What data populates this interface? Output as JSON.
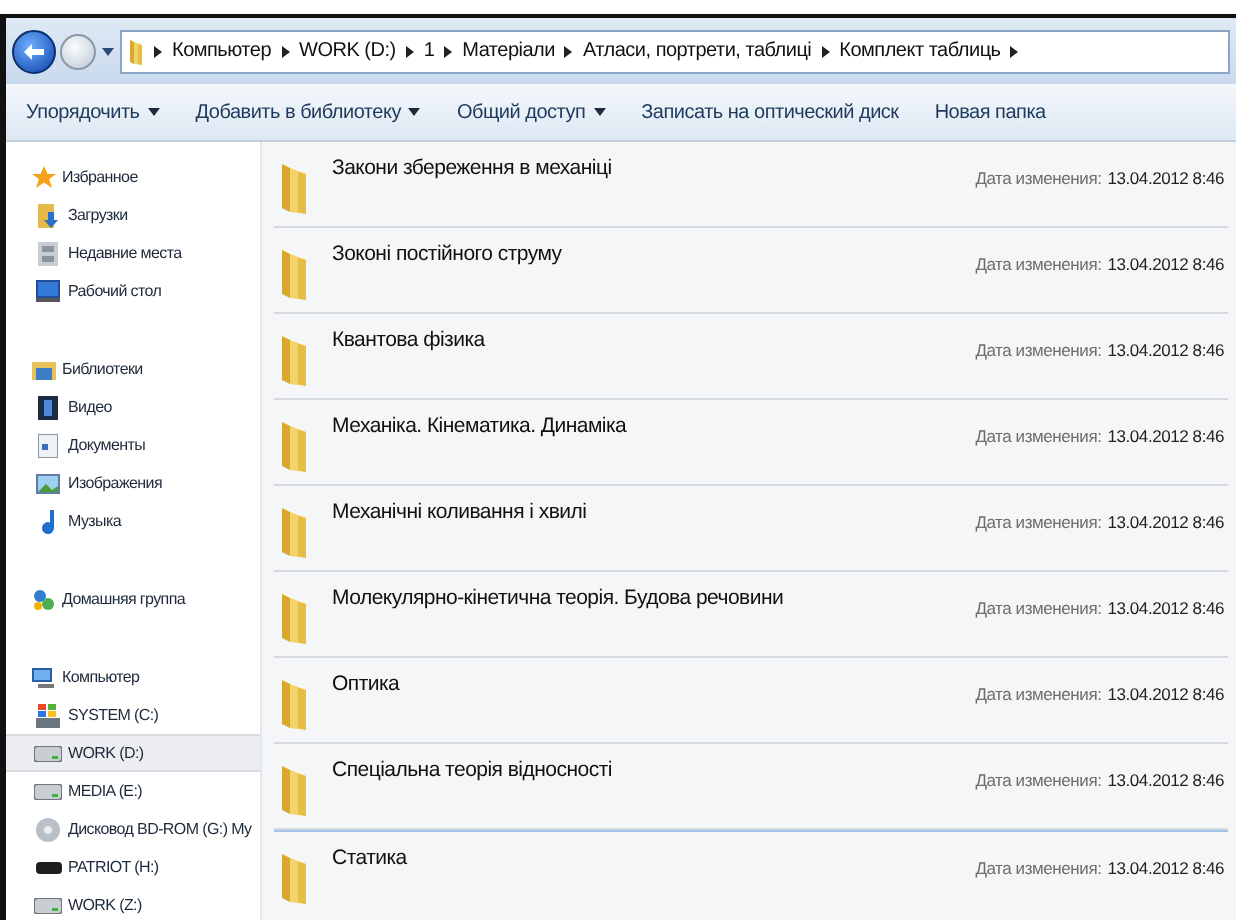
{
  "address_bar": {
    "crumbs": [
      "Компьютер",
      "WORK (D:)",
      "1",
      "Матеріали",
      "Атласи, портрети, таблиці",
      "Комплект таблиць"
    ]
  },
  "toolbar": [
    {
      "label": "Упорядочить",
      "dropdown": true
    },
    {
      "label": "Добавить в библиотеку",
      "dropdown": true
    },
    {
      "label": "Общий доступ",
      "dropdown": true
    },
    {
      "label": "Записать на оптический диск",
      "dropdown": false
    },
    {
      "label": "Новая папка",
      "dropdown": false
    }
  ],
  "sidebar": [
    {
      "title": "Избранное",
      "items": [
        {
          "label": "Загрузки",
          "selected": false
        },
        {
          "label": "Недавние места",
          "selected": false
        },
        {
          "label": "Рабочий стол",
          "selected": false
        }
      ]
    },
    {
      "title": "Библиотеки",
      "items": [
        {
          "label": "Видео",
          "selected": false
        },
        {
          "label": "Документы",
          "selected": false
        },
        {
          "label": "Изображения",
          "selected": false
        },
        {
          "label": "Музыка",
          "selected": false
        }
      ]
    },
    {
      "title": "Домашняя группа"
    },
    {
      "title": "Компьютер",
      "items": [
        {
          "label": "SYSTEM (C:)",
          "selected": false
        },
        {
          "label": "WORK (D:)",
          "selected": true
        },
        {
          "label": "MEDIA (E:)",
          "selected": false
        },
        {
          "label": "Дисковод BD-ROM (G:) My",
          "selected": false
        },
        {
          "label": "PATRIOT (H:)",
          "selected": false
        },
        {
          "label": "WORK (Z:)",
          "selected": false
        }
      ]
    }
  ],
  "files": [
    {
      "name": "Закони збереження в механіці",
      "date_label": "Дата изменения:",
      "date": "13.04.2012 8:46",
      "focused": false
    },
    {
      "name": "Зоконі постійного струму",
      "date_label": "Дата изменения:",
      "date": "13.04.2012 8:46",
      "focused": false
    },
    {
      "name": "Квантова фізика",
      "date_label": "Дата изменения:",
      "date": "13.04.2012 8:46",
      "focused": false
    },
    {
      "name": "Механіка. Кінематика. Динаміка",
      "date_label": "Дата изменения:",
      "date": "13.04.2012 8:46",
      "focused": false
    },
    {
      "name": "Механічні коливання і хвилі",
      "date_label": "Дата изменения:",
      "date": "13.04.2012 8:46",
      "focused": false
    },
    {
      "name": "Молекулярно-кінетична теорія. Будова речовини",
      "date_label": "Дата изменения:",
      "date": "13.04.2012 8:46",
      "focused": false
    },
    {
      "name": "Оптика",
      "date_label": "Дата изменения:",
      "date": "13.04.2012 8:46",
      "focused": false
    },
    {
      "name": "Спеціальна теорія відносності",
      "date_label": "Дата изменения:",
      "date": "13.04.2012 8:46",
      "focused": false
    },
    {
      "name": "Статика",
      "date_label": "Дата изменения:",
      "date": "13.04.2012 8:46",
      "focused": true
    }
  ]
}
